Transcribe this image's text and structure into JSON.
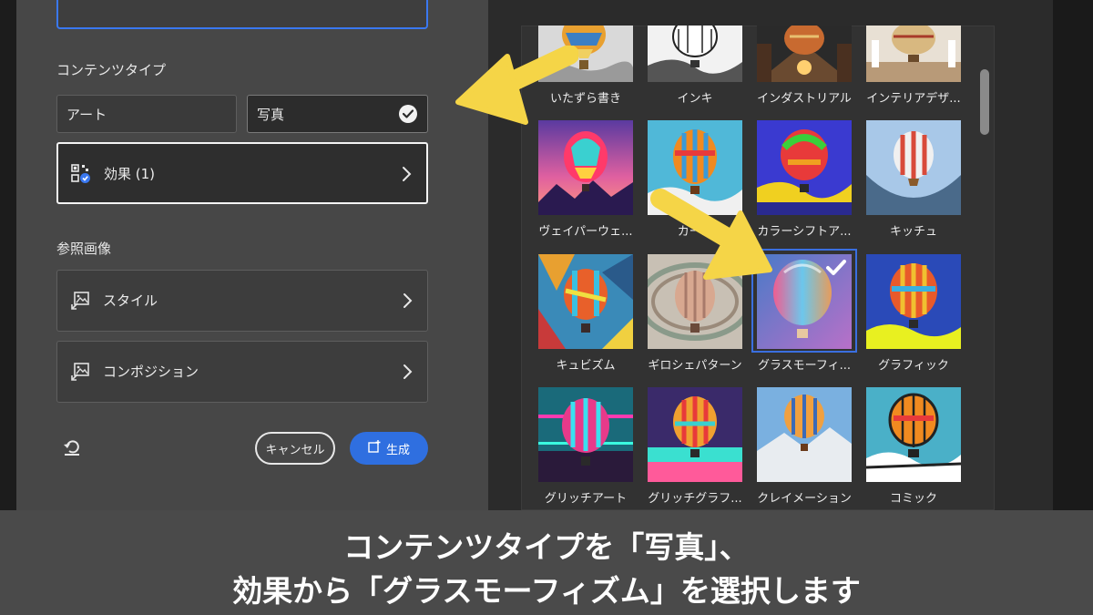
{
  "left_panel": {
    "content_type_label": "コンテンツタイプ",
    "type_art_label": "アート",
    "type_photo_label": "写真",
    "effects_label": "効果 (1)",
    "reference_image_label": "参照画像",
    "style_label": "スタイル",
    "composition_label": "コンポジション",
    "cancel_label": "キャンセル",
    "generate_label": "生成"
  },
  "gallery": {
    "items": [
      {
        "label": "いたずら書き",
        "selected": false
      },
      {
        "label": "インキ",
        "selected": false
      },
      {
        "label": "インダストリアル",
        "selected": false
      },
      {
        "label": "インテリアデザ...",
        "selected": false
      },
      {
        "label": "ヴェイパーウェ...",
        "selected": false
      },
      {
        "label": "カー...",
        "selected": false
      },
      {
        "label": "カラーシフトア...",
        "selected": false
      },
      {
        "label": "キッチュ",
        "selected": false
      },
      {
        "label": "キュビズム",
        "selected": false
      },
      {
        "label": "ギロシェパターン",
        "selected": false
      },
      {
        "label": "グラスモーフィ...",
        "selected": true
      },
      {
        "label": "グラフィック",
        "selected": false
      },
      {
        "label": "グリッチアート",
        "selected": false
      },
      {
        "label": "グリッチグラフ...",
        "selected": false
      },
      {
        "label": "クレイメーション",
        "selected": false
      },
      {
        "label": "コミック",
        "selected": false
      }
    ]
  },
  "caption": {
    "line1": "コンテンツタイプを「写真」、",
    "line2": "効果から「グラスモーフィズム」を選択します"
  },
  "colors": {
    "accent_blue": "#2f6fe0",
    "arrow_yellow": "#f5d547"
  }
}
